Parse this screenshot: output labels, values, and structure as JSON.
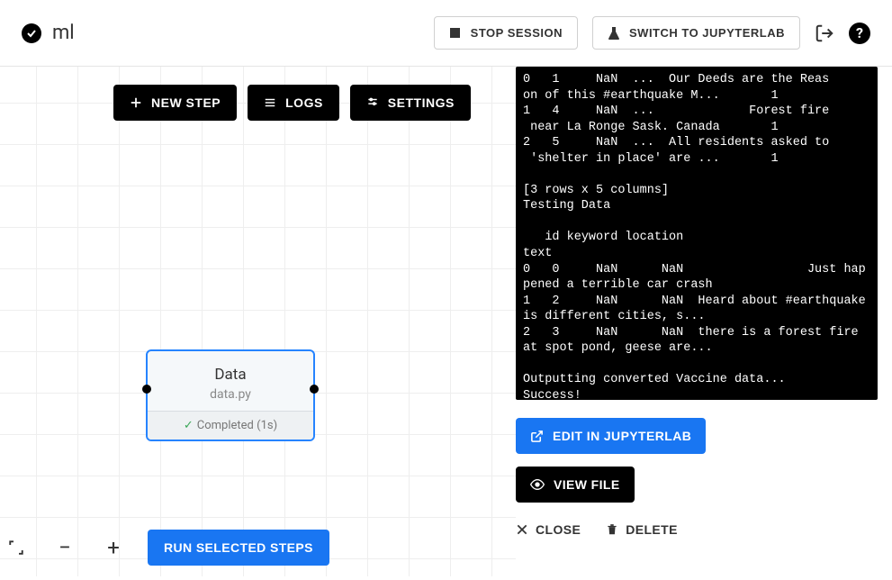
{
  "header": {
    "title": "ml",
    "stop_session": "STOP SESSION",
    "switch_jupyter": "SWITCH TO JUPYTERLAB"
  },
  "toolbar": {
    "new_step": "NEW STEP",
    "logs": "LOGS",
    "settings": "SETTINGS"
  },
  "node": {
    "title": "Data",
    "file": "data.py",
    "status": "Completed (1s)"
  },
  "bottom": {
    "run_selected": "RUN SELECTED STEPS"
  },
  "terminal_lines": [
    "0   1     NaN  ...  Our Deeds are the Reas",
    "on of this #earthquake M...       1",
    "1   4     NaN  ...             Forest fire",
    " near La Ronge Sask. Canada       1",
    "2   5     NaN  ...  All residents asked to",
    " 'shelter in place' are ...       1",
    "",
    "[3 rows x 5 columns]",
    "Testing Data",
    "",
    "   id keyword location                                               text",
    "0   0     NaN      NaN                 Just happened a terrible car crash",
    "1   2     NaN      NaN  Heard about #earthquake is different cities, s...",
    "2   3     NaN      NaN  there is a forest fire at spot pond, geese are...",
    "",
    "Outputting converted Vaccine data...",
    "Success!"
  ],
  "panel": {
    "edit_jupyter": "EDIT IN JUPYTERLAB",
    "view_file": "VIEW FILE",
    "close": "CLOSE",
    "delete": "DELETE"
  }
}
